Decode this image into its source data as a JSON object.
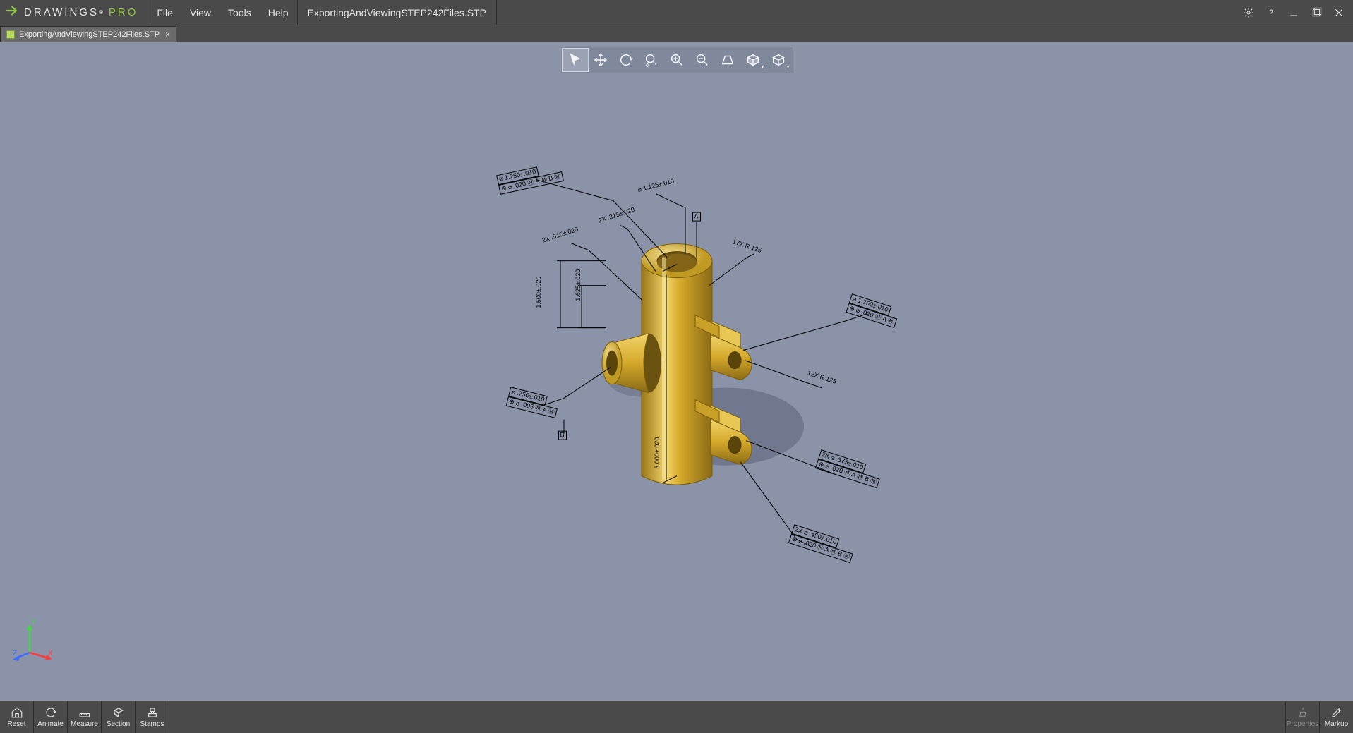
{
  "app": {
    "logo_drawings": "DRAWINGS",
    "logo_pro": "PRO",
    "registered": "®"
  },
  "menu": {
    "file": "File",
    "view": "View",
    "tools": "Tools",
    "help": "Help"
  },
  "document_title": "ExportingAndViewingSTEP242Files.STP",
  "tab": {
    "label": "ExportingAndViewingSTEP242Files.STP"
  },
  "view_toolbar": {
    "select": "Select",
    "pan": "Pan",
    "rotate": "Rotate",
    "zoom_area": "Zoom to Area",
    "zoom_in": "Zoom In",
    "zoom_out": "Zoom Out",
    "perspective": "Perspective",
    "display_style": "Display Style",
    "view_orientation": "View Orientation"
  },
  "triad": {
    "x": "X",
    "y": "Y",
    "z": "Z"
  },
  "annotations": {
    "a1": "⌀ 1.250±.010",
    "a1b": "⊕ ⌀ .020 Ⓜ A Ⓜ B Ⓜ",
    "a2": "2X .315±.020",
    "a3": "2X .515±.020",
    "a4": "⌀ 1.125±.010",
    "a4b": "A",
    "a5": "17X R.125",
    "a6": "1.625±.020",
    "a7": "1.500±.020",
    "a8": "⌀ .750±.010",
    "a8b": "⊕ ⌀ .005 Ⓜ A Ⓜ",
    "a8c": "B",
    "a9": "3.000±.020",
    "a10": "12X R.125",
    "a11": "⌀ 1.750±.010",
    "a11b": "⊕ ⌀ .020 Ⓜ A Ⓜ",
    "a12": "2X ⌀ .375±.010",
    "a12b": "⊕ ⌀ .020 Ⓜ A Ⓜ B Ⓜ",
    "a13": "2X ⌀ .450±.010",
    "a13b": "⊕ ⌀ .020 Ⓜ A Ⓜ B Ⓜ"
  },
  "bottombar": {
    "reset": "Reset",
    "animate": "Animate",
    "measure": "Measure",
    "section": "Section",
    "stamps": "Stamps",
    "properties": "Properties",
    "markup": "Markup"
  },
  "colors": {
    "model_gold": "#d4a82a",
    "model_gold_dark": "#a07b18",
    "model_gold_light": "#f2d56a",
    "accent_green": "#8fc63f"
  }
}
